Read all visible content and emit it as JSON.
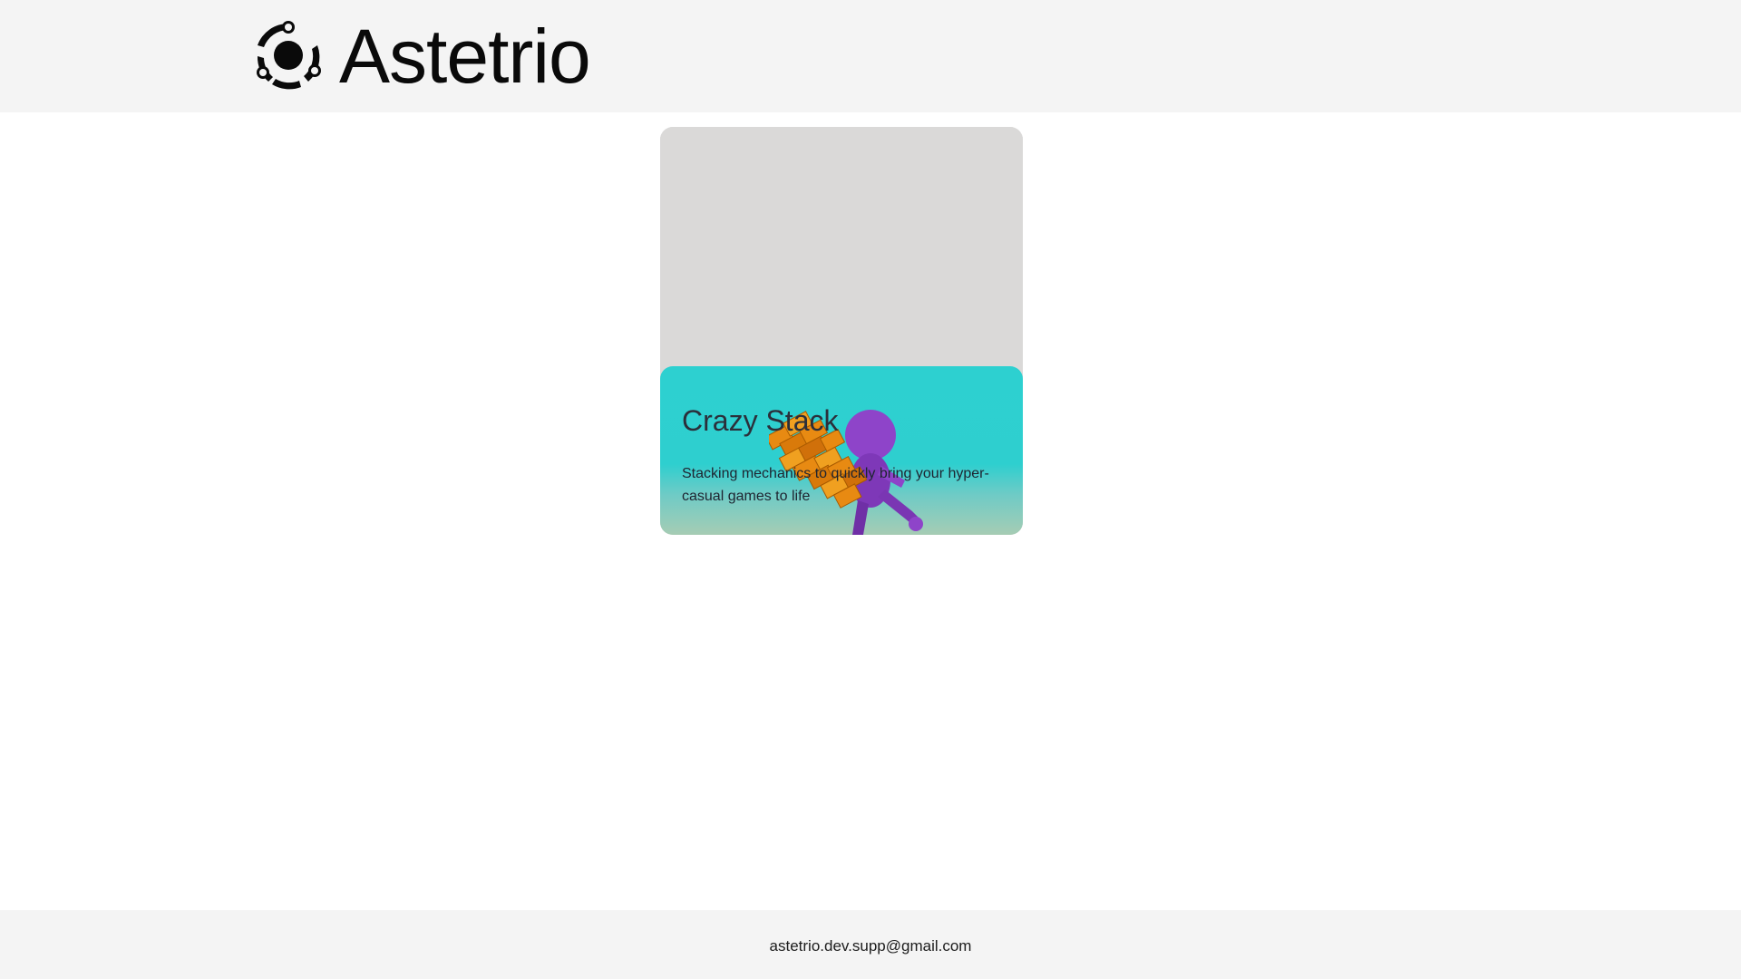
{
  "header": {
    "brand_name": "Astetrio",
    "logo_icon": "astetrio-logo-icon"
  },
  "card": {
    "title": "Crazy Stack",
    "description": "Stacking mechanics to quickly bring your hyper-casual games to life",
    "art_icon": "stacked-boxes-character-illustration",
    "panel_color": "#2dd0d0",
    "media_color": "#dad9d8"
  },
  "footer": {
    "email": "astetrio.dev.supp@gmail.com"
  }
}
